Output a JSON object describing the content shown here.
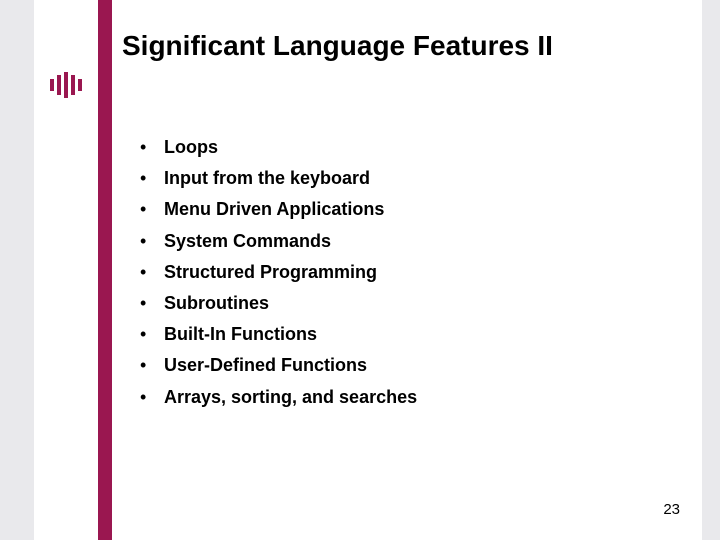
{
  "title": "Significant Language Features II",
  "bullets": [
    "Loops",
    "Input from the keyboard",
    "Menu Driven Applications",
    "System Commands",
    "Structured Programming",
    "Subroutines",
    "Built-In Functions",
    "User-Defined Functions",
    "Arrays, sorting, and searches"
  ],
  "page_number": "23",
  "accent_color": "#9a1750"
}
